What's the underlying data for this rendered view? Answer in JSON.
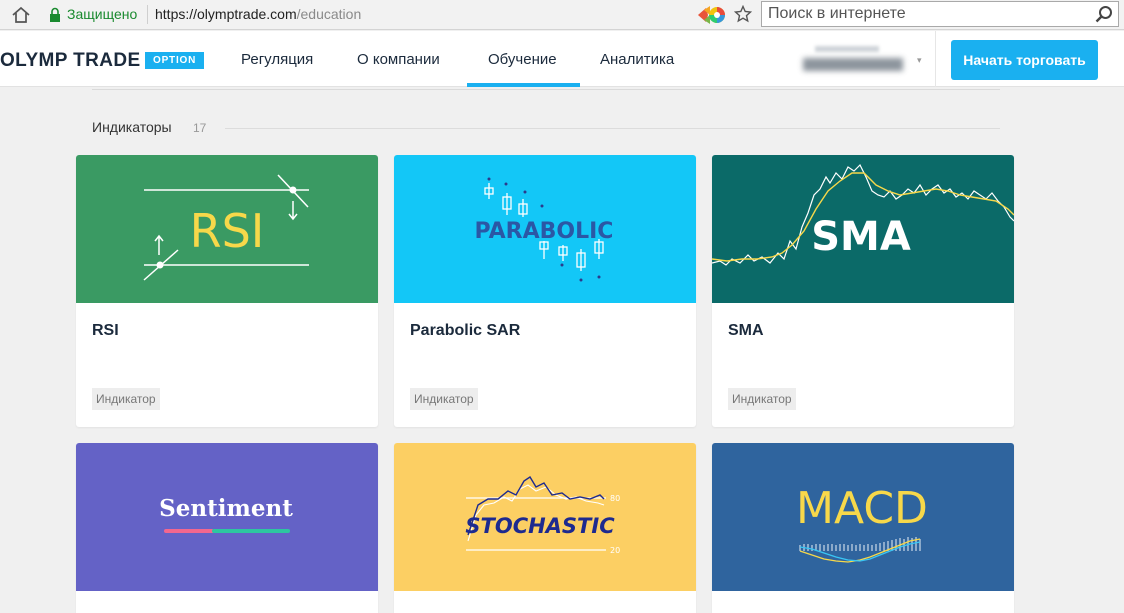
{
  "browser": {
    "secure_label": "Защищено",
    "url_host": "https://olymptrade.com",
    "url_path": "/education",
    "search_placeholder": "Поиск в интернете"
  },
  "header": {
    "logo": "OLYMP TRADE",
    "badge": "OPTION",
    "nav": [
      {
        "label": "Регуляция"
      },
      {
        "label": "О компании"
      },
      {
        "label": "Обучение",
        "active": true
      },
      {
        "label": "Аналитика"
      }
    ],
    "cta": "Начать торговать"
  },
  "section": {
    "title": "Индикаторы",
    "count": "17"
  },
  "cards": [
    {
      "title": "RSI",
      "tag": "Индикатор",
      "image_text": "RSI",
      "color": "#3a9a63"
    },
    {
      "title": "Parabolic SAR",
      "tag": "Индикатор",
      "image_text": "PARABOLIC",
      "color": "#13c7f7"
    },
    {
      "title": "SMA",
      "tag": "Индикатор",
      "image_text": "SMA",
      "color": "#0b6a68"
    },
    {
      "image_text": "Sentiment",
      "color": "#6462c6"
    },
    {
      "image_text": "STOCHASTIC",
      "chart_high": "80",
      "chart_low": "20",
      "color": "#fccf63"
    },
    {
      "image_text": "MACD",
      "color": "#2f649e"
    }
  ]
}
